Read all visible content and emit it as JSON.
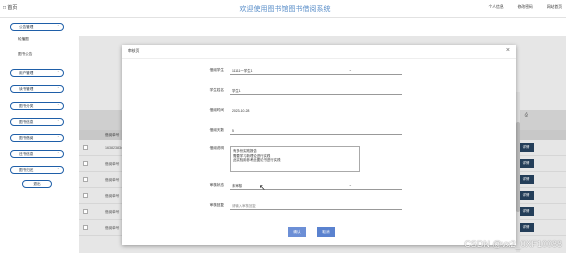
{
  "topbar": {
    "home": "□ 首页",
    "title": "欢迎使用图书馆图书借阅系统",
    "links": [
      "个人信息",
      "修改密码",
      "网站首页"
    ]
  },
  "sidebar": {
    "group1": "公告管理",
    "sub1": "轮播图",
    "sub2": "图书公告",
    "items": [
      "用户管理",
      "读书管理",
      "图书分类",
      "图书信息",
      "图书借阅",
      "还书信息",
      "图书归还",
      "退出"
    ]
  },
  "table": {
    "headers": [
      "借阅单号",
      "借阅单号"
    ],
    "rows": [
      {
        "cell": "借阅单号",
        "detail": "详情"
      },
      {
        "cell": "1638238345",
        "detail": "详情"
      },
      {
        "cell": "借阅单号",
        "detail": "详情"
      },
      {
        "cell": "借阅单号",
        "detail": "详情"
      },
      {
        "cell": "借阅单号",
        "detail": "详情"
      },
      {
        "cell": "借阅单号",
        "detail": "详情"
      },
      {
        "cell": "借阅单号",
        "detail": "详情"
      }
    ]
  },
  "modal": {
    "title": "审核页",
    "close": "×",
    "fields": {
      "student_id_label": "借阅学生",
      "student_id_value": "11111一学生1",
      "student_name_label": "学生姓名",
      "student_name_value": "学生1",
      "borrow_time_label": "借阅时间",
      "borrow_time_value": "2023-10-28",
      "borrow_days_label": "借阅天数",
      "borrow_days_value": "5",
      "reason_label": "借阅说明",
      "reason_lines": [
        "有多份实践报告",
        "需要学习新理论进行实践",
        "此实验用参考此图论书进行实践"
      ],
      "status_label": "审核状态",
      "status_value": "未审核",
      "reply_label": "审核回复",
      "reply_placeholder": "请输入审核回复"
    },
    "ok": "确认",
    "cancel": "取消"
  },
  "watermark": "CSDN @vx2_0XF10088"
}
